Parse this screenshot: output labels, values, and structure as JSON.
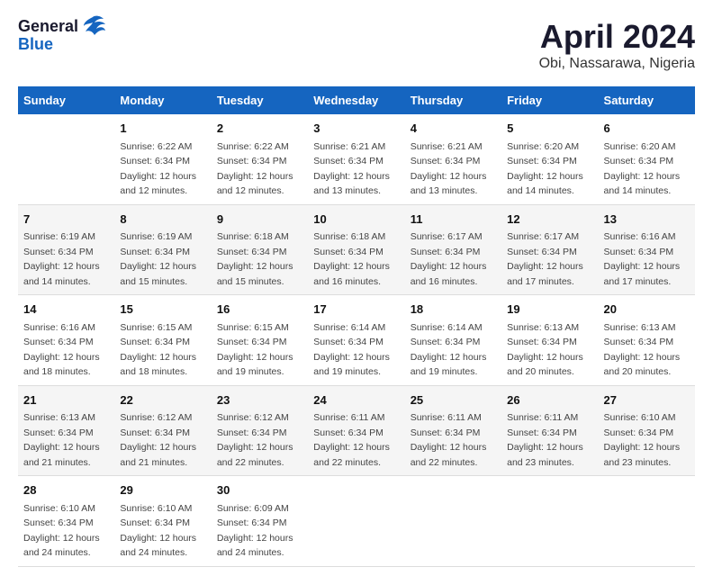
{
  "header": {
    "logo_general": "General",
    "logo_blue": "Blue",
    "title": "April 2024",
    "subtitle": "Obi, Nassarawa, Nigeria"
  },
  "calendar": {
    "days_of_week": [
      "Sunday",
      "Monday",
      "Tuesday",
      "Wednesday",
      "Thursday",
      "Friday",
      "Saturday"
    ],
    "weeks": [
      [
        {
          "day": "",
          "info": ""
        },
        {
          "day": "1",
          "info": "Sunrise: 6:22 AM\nSunset: 6:34 PM\nDaylight: 12 hours\nand 12 minutes."
        },
        {
          "day": "2",
          "info": "Sunrise: 6:22 AM\nSunset: 6:34 PM\nDaylight: 12 hours\nand 12 minutes."
        },
        {
          "day": "3",
          "info": "Sunrise: 6:21 AM\nSunset: 6:34 PM\nDaylight: 12 hours\nand 13 minutes."
        },
        {
          "day": "4",
          "info": "Sunrise: 6:21 AM\nSunset: 6:34 PM\nDaylight: 12 hours\nand 13 minutes."
        },
        {
          "day": "5",
          "info": "Sunrise: 6:20 AM\nSunset: 6:34 PM\nDaylight: 12 hours\nand 14 minutes."
        },
        {
          "day": "6",
          "info": "Sunrise: 6:20 AM\nSunset: 6:34 PM\nDaylight: 12 hours\nand 14 minutes."
        }
      ],
      [
        {
          "day": "7",
          "info": "Sunrise: 6:19 AM\nSunset: 6:34 PM\nDaylight: 12 hours\nand 14 minutes."
        },
        {
          "day": "8",
          "info": "Sunrise: 6:19 AM\nSunset: 6:34 PM\nDaylight: 12 hours\nand 15 minutes."
        },
        {
          "day": "9",
          "info": "Sunrise: 6:18 AM\nSunset: 6:34 PM\nDaylight: 12 hours\nand 15 minutes."
        },
        {
          "day": "10",
          "info": "Sunrise: 6:18 AM\nSunset: 6:34 PM\nDaylight: 12 hours\nand 16 minutes."
        },
        {
          "day": "11",
          "info": "Sunrise: 6:17 AM\nSunset: 6:34 PM\nDaylight: 12 hours\nand 16 minutes."
        },
        {
          "day": "12",
          "info": "Sunrise: 6:17 AM\nSunset: 6:34 PM\nDaylight: 12 hours\nand 17 minutes."
        },
        {
          "day": "13",
          "info": "Sunrise: 6:16 AM\nSunset: 6:34 PM\nDaylight: 12 hours\nand 17 minutes."
        }
      ],
      [
        {
          "day": "14",
          "info": "Sunrise: 6:16 AM\nSunset: 6:34 PM\nDaylight: 12 hours\nand 18 minutes."
        },
        {
          "day": "15",
          "info": "Sunrise: 6:15 AM\nSunset: 6:34 PM\nDaylight: 12 hours\nand 18 minutes."
        },
        {
          "day": "16",
          "info": "Sunrise: 6:15 AM\nSunset: 6:34 PM\nDaylight: 12 hours\nand 19 minutes."
        },
        {
          "day": "17",
          "info": "Sunrise: 6:14 AM\nSunset: 6:34 PM\nDaylight: 12 hours\nand 19 minutes."
        },
        {
          "day": "18",
          "info": "Sunrise: 6:14 AM\nSunset: 6:34 PM\nDaylight: 12 hours\nand 19 minutes."
        },
        {
          "day": "19",
          "info": "Sunrise: 6:13 AM\nSunset: 6:34 PM\nDaylight: 12 hours\nand 20 minutes."
        },
        {
          "day": "20",
          "info": "Sunrise: 6:13 AM\nSunset: 6:34 PM\nDaylight: 12 hours\nand 20 minutes."
        }
      ],
      [
        {
          "day": "21",
          "info": "Sunrise: 6:13 AM\nSunset: 6:34 PM\nDaylight: 12 hours\nand 21 minutes."
        },
        {
          "day": "22",
          "info": "Sunrise: 6:12 AM\nSunset: 6:34 PM\nDaylight: 12 hours\nand 21 minutes."
        },
        {
          "day": "23",
          "info": "Sunrise: 6:12 AM\nSunset: 6:34 PM\nDaylight: 12 hours\nand 22 minutes."
        },
        {
          "day": "24",
          "info": "Sunrise: 6:11 AM\nSunset: 6:34 PM\nDaylight: 12 hours\nand 22 minutes."
        },
        {
          "day": "25",
          "info": "Sunrise: 6:11 AM\nSunset: 6:34 PM\nDaylight: 12 hours\nand 22 minutes."
        },
        {
          "day": "26",
          "info": "Sunrise: 6:11 AM\nSunset: 6:34 PM\nDaylight: 12 hours\nand 23 minutes."
        },
        {
          "day": "27",
          "info": "Sunrise: 6:10 AM\nSunset: 6:34 PM\nDaylight: 12 hours\nand 23 minutes."
        }
      ],
      [
        {
          "day": "28",
          "info": "Sunrise: 6:10 AM\nSunset: 6:34 PM\nDaylight: 12 hours\nand 24 minutes."
        },
        {
          "day": "29",
          "info": "Sunrise: 6:10 AM\nSunset: 6:34 PM\nDaylight: 12 hours\nand 24 minutes."
        },
        {
          "day": "30",
          "info": "Sunrise: 6:09 AM\nSunset: 6:34 PM\nDaylight: 12 hours\nand 24 minutes."
        },
        {
          "day": "",
          "info": ""
        },
        {
          "day": "",
          "info": ""
        },
        {
          "day": "",
          "info": ""
        },
        {
          "day": "",
          "info": ""
        }
      ]
    ]
  }
}
